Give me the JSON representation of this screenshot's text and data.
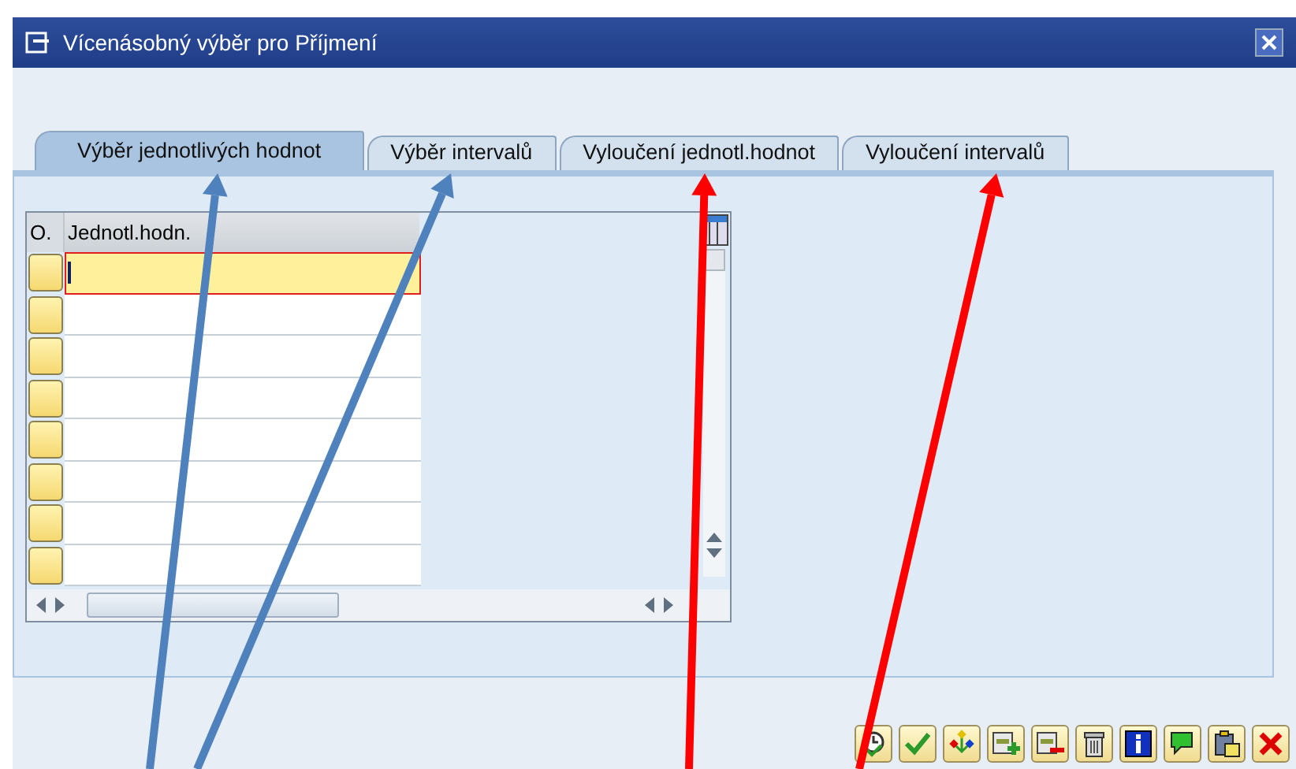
{
  "window": {
    "title": "Vícenásobný výběr pro Příjmení"
  },
  "tabs": [
    {
      "label": "Výběr jednotlivých hodnot",
      "selected": true
    },
    {
      "label": "Výběr intervalů",
      "selected": false
    },
    {
      "label": "Vyloučení jednotl.hodnot",
      "selected": false
    },
    {
      "label": "Vyloučení intervalů",
      "selected": false
    }
  ],
  "table": {
    "columns": [
      "O.",
      "Jednotl.hodn."
    ],
    "rows": [
      {
        "selected": true
      },
      {
        "selected": false
      },
      {
        "selected": false
      },
      {
        "selected": false
      },
      {
        "selected": false
      },
      {
        "selected": false
      },
      {
        "selected": false
      },
      {
        "selected": false
      }
    ]
  },
  "toolbar": [
    {
      "kind": "clock"
    },
    {
      "kind": "check"
    },
    {
      "kind": "tree"
    },
    {
      "kind": "add"
    },
    {
      "kind": "remove"
    },
    {
      "kind": "trash"
    },
    {
      "kind": "info"
    },
    {
      "kind": "comment"
    },
    {
      "kind": "clipboard"
    },
    {
      "kind": "cancel"
    }
  ],
  "annotations": [
    {
      "color": "#4f81bd"
    },
    {
      "color": "#4f81bd"
    },
    {
      "color": "#ff0000"
    },
    {
      "color": "#ff0000"
    }
  ]
}
